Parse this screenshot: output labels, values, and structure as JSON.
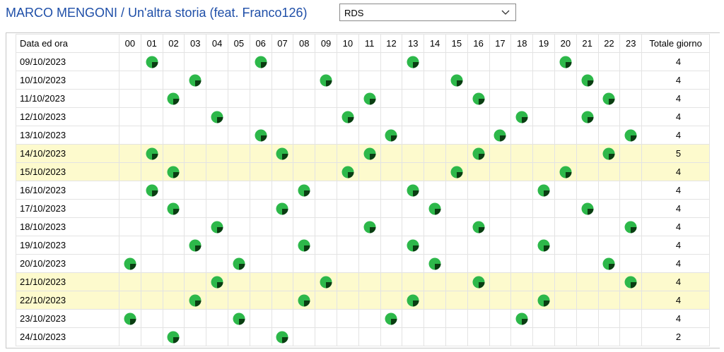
{
  "header": {
    "title": "MARCO MENGONI / Un'altra storia (feat. Franco126)",
    "station": "RDS"
  },
  "table": {
    "date_header": "Data ed ora",
    "hours": [
      "00",
      "01",
      "02",
      "03",
      "04",
      "05",
      "06",
      "07",
      "08",
      "09",
      "10",
      "11",
      "12",
      "13",
      "14",
      "15",
      "16",
      "17",
      "18",
      "19",
      "20",
      "21",
      "22",
      "23"
    ],
    "total_header": "Totale giorno",
    "rows": [
      {
        "date": "09/10/2023",
        "plays": [
          1,
          6,
          13,
          20
        ],
        "total": "4",
        "highlight": false
      },
      {
        "date": "10/10/2023",
        "plays": [
          3,
          9,
          15,
          21
        ],
        "total": "4",
        "highlight": false
      },
      {
        "date": "11/10/2023",
        "plays": [
          2,
          11,
          16,
          22
        ],
        "total": "4",
        "highlight": false
      },
      {
        "date": "12/10/2023",
        "plays": [
          4,
          10,
          18,
          21
        ],
        "total": "4",
        "highlight": false
      },
      {
        "date": "13/10/2023",
        "plays": [
          6,
          12,
          17,
          23
        ],
        "total": "4",
        "highlight": false
      },
      {
        "date": "14/10/2023",
        "plays": [
          1,
          7,
          11,
          16,
          22
        ],
        "total": "5",
        "highlight": true
      },
      {
        "date": "15/10/2023",
        "plays": [
          2,
          10,
          15,
          20
        ],
        "total": "4",
        "highlight": true
      },
      {
        "date": "16/10/2023",
        "plays": [
          1,
          8,
          13,
          19
        ],
        "total": "4",
        "highlight": false
      },
      {
        "date": "17/10/2023",
        "plays": [
          2,
          7,
          14,
          21
        ],
        "total": "4",
        "highlight": false
      },
      {
        "date": "18/10/2023",
        "plays": [
          4,
          11,
          16,
          23
        ],
        "total": "4",
        "highlight": false
      },
      {
        "date": "19/10/2023",
        "plays": [
          3,
          8,
          13,
          19
        ],
        "total": "4",
        "highlight": false
      },
      {
        "date": "20/10/2023",
        "plays": [
          0,
          5,
          14,
          22
        ],
        "total": "4",
        "highlight": false
      },
      {
        "date": "21/10/2023",
        "plays": [
          4,
          9,
          16,
          23
        ],
        "total": "4",
        "highlight": true
      },
      {
        "date": "22/10/2023",
        "plays": [
          3,
          8,
          13,
          19
        ],
        "total": "4",
        "highlight": true
      },
      {
        "date": "23/10/2023",
        "plays": [
          0,
          5,
          12,
          18
        ],
        "total": "4",
        "highlight": false
      },
      {
        "date": "24/10/2023",
        "plays": [
          2,
          7
        ],
        "total": "2",
        "highlight": false
      }
    ]
  },
  "colors": {
    "title": "#1f4fa8",
    "dot_green": "#2db84a",
    "dot_dark": "#0a3d12",
    "highlight_row": "#fdfacd",
    "grid_line": "#e3e3e3"
  },
  "icons": {
    "dropdown": "chevron-down-icon",
    "play_marker": "play-dot-icon"
  }
}
